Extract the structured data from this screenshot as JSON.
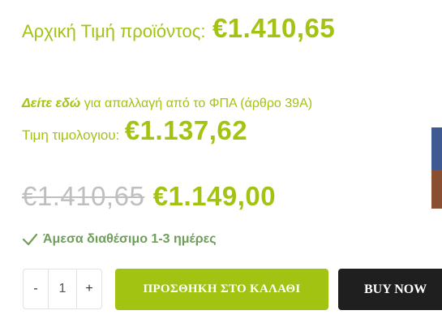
{
  "pricing": {
    "original_label": "Αρχική Τιμή προϊόντος:",
    "original_value": "€1.410,65",
    "vat_link": "Δείτε εδώ",
    "vat_text": " για απαλλαγή από το ΦΠΑ (άρθρο 39Α)",
    "invoice_label": "Τιμη τιμολογιου:",
    "invoice_value": "€1.137,62",
    "old_price": "€1.410,65",
    "new_price": "€1.149,00"
  },
  "availability": {
    "icon": "check-icon",
    "text": "Άμεσα διαθέσιμο 1-3 ημέρες"
  },
  "quantity": {
    "minus": "-",
    "value": "1",
    "plus": "+"
  },
  "actions": {
    "add_to_cart": "ΠΡΟΣΘΗΚΗ ΣΤΟ ΚΑΛΑΘΙ",
    "buy_now": "BUY NOW"
  },
  "colors": {
    "accent": "#a3c313",
    "availability": "#6f9e5b",
    "buy_now_bg": "#1f1f1f"
  }
}
